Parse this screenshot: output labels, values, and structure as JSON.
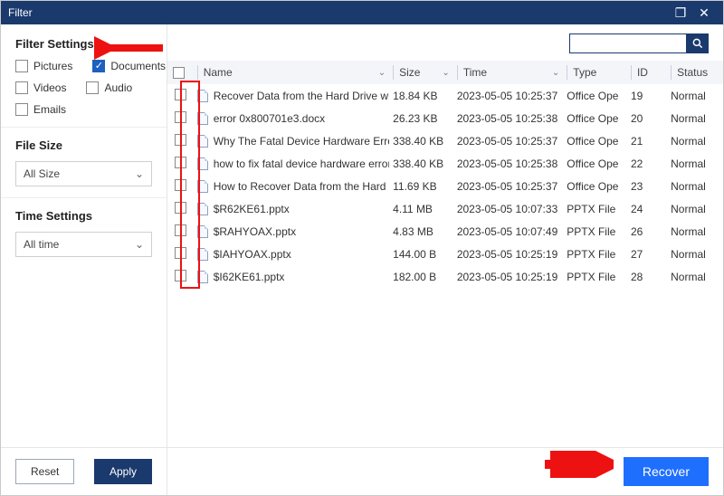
{
  "window": {
    "title": "Filter",
    "max_icon": "❐",
    "close_icon": "✕"
  },
  "sidebar": {
    "settings_title": "Filter Settings",
    "filters": {
      "pictures": {
        "label": "Pictures",
        "checked": false
      },
      "documents": {
        "label": "Documents",
        "checked": true
      },
      "videos": {
        "label": "Videos",
        "checked": false
      },
      "audio": {
        "label": "Audio",
        "checked": false
      },
      "emails": {
        "label": "Emails",
        "checked": false
      }
    },
    "filesize": {
      "title": "File Size",
      "value": "All Size"
    },
    "timesettings": {
      "title": "Time Settings",
      "value": "All time"
    },
    "reset": "Reset",
    "apply": "Apply"
  },
  "search": {
    "value": "",
    "placeholder": ""
  },
  "table": {
    "headers": {
      "name": "Name",
      "size": "Size",
      "time": "Time",
      "type": "Type",
      "id": "ID",
      "status": "Status"
    },
    "rows": [
      {
        "name": "Recover Data from the Hard Drive with F",
        "size": "18.84 KB",
        "time": "2023-05-05 10:25:37",
        "type": "Office Ope",
        "id": "19",
        "status": "Normal"
      },
      {
        "name": "error 0x800701e3.docx",
        "size": "26.23 KB",
        "time": "2023-05-05 10:25:38",
        "type": "Office Ope",
        "id": "20",
        "status": "Normal"
      },
      {
        "name": "Why The Fatal Device Hardware Error Ap",
        "size": "338.40 KB",
        "time": "2023-05-05 10:25:37",
        "type": "Office Ope",
        "id": "21",
        "status": "Normal"
      },
      {
        "name": "how to fix fatal device hardware error.dc",
        "size": "338.40 KB",
        "time": "2023-05-05 10:25:38",
        "type": "Office Ope",
        "id": "22",
        "status": "Normal"
      },
      {
        "name": "How to Recover Data from the Hard Driv",
        "size": "11.69 KB",
        "time": "2023-05-05 10:25:37",
        "type": "Office Ope",
        "id": "23",
        "status": "Normal"
      },
      {
        "name": "$R62KE61.pptx",
        "size": "4.11 MB",
        "time": "2023-05-05 10:07:33",
        "type": "PPTX File",
        "id": "24",
        "status": "Normal"
      },
      {
        "name": "$RAHYOAX.pptx",
        "size": "4.83 MB",
        "time": "2023-05-05 10:07:49",
        "type": "PPTX File",
        "id": "26",
        "status": "Normal"
      },
      {
        "name": "$IAHYOAX.pptx",
        "size": "144.00 B",
        "time": "2023-05-05 10:25:19",
        "type": "PPTX File",
        "id": "27",
        "status": "Normal"
      },
      {
        "name": "$I62KE61.pptx",
        "size": "182.00 B",
        "time": "2023-05-05 10:25:19",
        "type": "PPTX File",
        "id": "28",
        "status": "Normal"
      }
    ]
  },
  "footer": {
    "recover": "Recover"
  }
}
